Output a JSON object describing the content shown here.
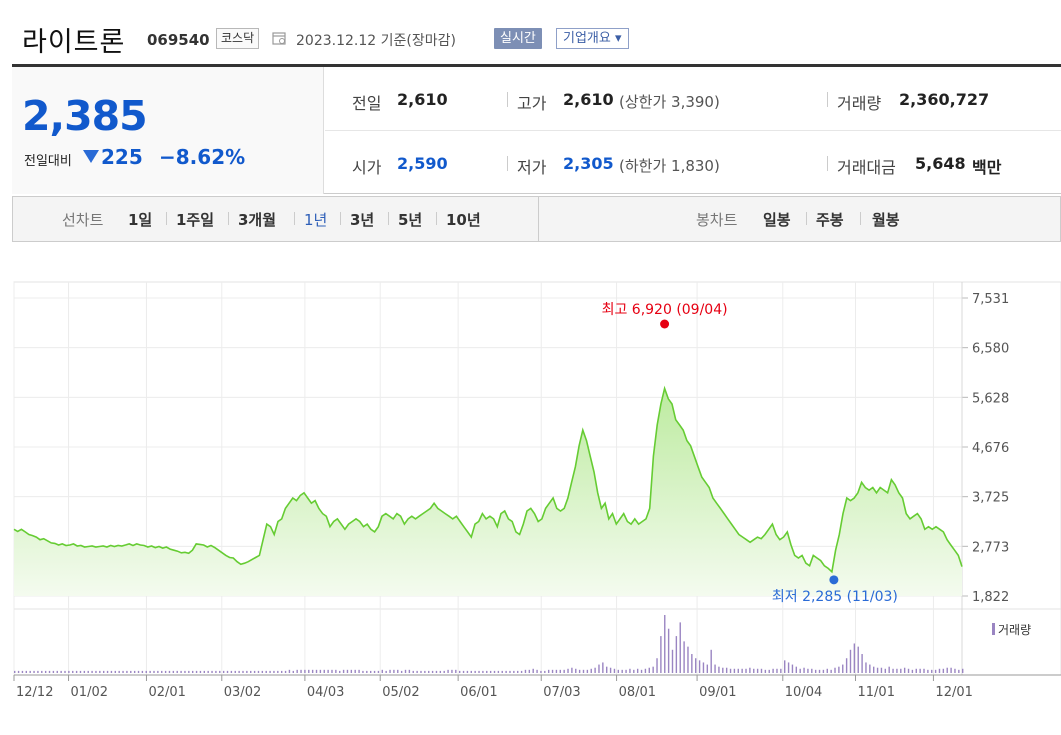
{
  "header": {
    "company_name": "라이트론",
    "code": "069540",
    "market_badge": "코스닥",
    "date_text": "2023.12.12  기준(장마감)",
    "realtime_label": "실시간",
    "company_info_label": "기업개요 ▾"
  },
  "summary": {
    "price": "2,385",
    "change_label": "전일대비",
    "change_value": "225",
    "change_pct": "−8.62%",
    "prev_label": "전일",
    "prev_value": "2,610",
    "open_label": "시가",
    "open_value": "2,590",
    "high_label": "고가",
    "high_value": "2,610",
    "high_sub": "(상한가 3,390)",
    "low_label": "저가",
    "low_value": "2,305",
    "low_sub": "(하한가 1,830)",
    "volume_label": "거래량",
    "volume_value": "2,360,727",
    "amount_label": "거래대금",
    "amount_value": "5,648",
    "amount_unit": "백만"
  },
  "tabs": {
    "line_label": "선차트",
    "periods": [
      "1일",
      "1주일",
      "3개월",
      "1년",
      "3년",
      "5년",
      "10년"
    ],
    "selected": "1년",
    "candle_label": "봉차트",
    "candles": [
      "일봉",
      "주봉",
      "월봉"
    ]
  },
  "colors": {
    "line": "#66cc33",
    "fill_top": "#bdeba0",
    "fill_bottom": "#f4fbef",
    "max_dot": "#e60012",
    "min_dot": "#2a6bd6",
    "volume": "#9a85c2"
  },
  "chart_data": {
    "type": "area",
    "title": "",
    "y_ticks": [
      "7,531",
      "6,580",
      "5,628",
      "4,676",
      "3,725",
      "2,773",
      "1,822"
    ],
    "ylim": [
      1822,
      7531
    ],
    "x_ticks": [
      "12/12",
      "01/02",
      "02/01",
      "03/02",
      "04/03",
      "05/02",
      "06/01",
      "07/03",
      "08/01",
      "09/01",
      "10/04",
      "11/01",
      "12/01"
    ],
    "grid": true,
    "max_annotation": "최고 6,920 (09/04)",
    "min_annotation": "최저 2,285 (11/03)",
    "volume_legend": "거래량",
    "series": [
      {
        "values": [
          3100,
          3060,
          3100,
          3050,
          3000,
          2980,
          2950,
          2900,
          2920,
          2880,
          2840,
          2830,
          2800,
          2820,
          2790,
          2800,
          2820,
          2780,
          2790,
          2760,
          2770,
          2780,
          2760,
          2770,
          2780,
          2760,
          2790,
          2770,
          2790,
          2780,
          2800,
          2820,
          2790,
          2820,
          2800,
          2790,
          2760,
          2780,
          2750,
          2770,
          2740,
          2760,
          2720,
          2700,
          2680,
          2650,
          2660,
          2640,
          2700,
          2820,
          2810,
          2800,
          2760,
          2790,
          2750,
          2700,
          2650,
          2600,
          2560,
          2550,
          2480,
          2430,
          2450,
          2480,
          2520,
          2560,
          2600,
          2900,
          3200,
          3150,
          3000,
          3250,
          3300,
          3500,
          3600,
          3700,
          3650,
          3750,
          3800,
          3700,
          3600,
          3650,
          3500,
          3400,
          3350,
          3150,
          3250,
          3300,
          3200,
          3100,
          3200,
          3250,
          3300,
          3250,
          3150,
          3200,
          3100,
          3050,
          3150,
          3350,
          3400,
          3350,
          3300,
          3400,
          3350,
          3200,
          3300,
          3350,
          3300,
          3350,
          3400,
          3450,
          3500,
          3600,
          3500,
          3450,
          3400,
          3350,
          3300,
          3350,
          3250,
          3150,
          3050,
          2950,
          3200,
          3250,
          3400,
          3300,
          3350,
          3300,
          3150,
          3400,
          3450,
          3300,
          3250,
          3050,
          3000,
          3200,
          3450,
          3500,
          3400,
          3250,
          3300,
          3500,
          3600,
          3700,
          3500,
          3450,
          3500,
          3700,
          4000,
          4300,
          4700,
          5000,
          4800,
          4500,
          4200,
          3800,
          3500,
          3600,
          3300,
          3400,
          3200,
          3300,
          3400,
          3250,
          3200,
          3300,
          3200,
          3250,
          3300,
          3500,
          4500,
          5100,
          5500,
          5800,
          5600,
          5500,
          5200,
          5100,
          5000,
          4800,
          4700,
          4500,
          4300,
          4100,
          4000,
          3900,
          3700,
          3600,
          3500,
          3400,
          3300,
          3200,
          3100,
          3000,
          2950,
          2900,
          2850,
          2900,
          2950,
          2920,
          3000,
          3100,
          3200,
          3000,
          2900,
          2950,
          3050,
          2800,
          2600,
          2550,
          2600,
          2450,
          2400,
          2600,
          2550,
          2500,
          2400,
          2350,
          2285,
          2700,
          3000,
          3400,
          3700,
          3650,
          3700,
          3800,
          4000,
          3900,
          3850,
          3900,
          3800,
          3900,
          3850,
          3800,
          4050,
          3950,
          3800,
          3700,
          3400,
          3300,
          3350,
          3400,
          3300,
          3100,
          3150,
          3100,
          3150,
          3100,
          3050,
          2900,
          2800,
          2700,
          2600,
          2385
        ]
      }
    ],
    "volume_bars": [
      2,
      2,
      2,
      2,
      2,
      2,
      2,
      2,
      2,
      2,
      2,
      2,
      2,
      2,
      2,
      2,
      2,
      2,
      2,
      2,
      2,
      2,
      2,
      2,
      2,
      2,
      2,
      2,
      2,
      2,
      2,
      2,
      2,
      2,
      2,
      2,
      2,
      2,
      2,
      2,
      2,
      2,
      2,
      2,
      2,
      2,
      2,
      2,
      2,
      2,
      2,
      2,
      2,
      2,
      2,
      2,
      2,
      2,
      2,
      2,
      2,
      2,
      2,
      2,
      2,
      2,
      2,
      2,
      2,
      2,
      2,
      3,
      2,
      3,
      3,
      3,
      3,
      3,
      3,
      3,
      3,
      3,
      3,
      3,
      2,
      3,
      3,
      3,
      3,
      3,
      2,
      2,
      2,
      2,
      2,
      3,
      2,
      3,
      3,
      3,
      2,
      3,
      3,
      2,
      2,
      2,
      2,
      2,
      2,
      2,
      2,
      2,
      3,
      3,
      3,
      2,
      2,
      2,
      2,
      2,
      2,
      2,
      2,
      2,
      2,
      2,
      2,
      2,
      2,
      2,
      2,
      2,
      3,
      3,
      4,
      3,
      2,
      2,
      3,
      3,
      3,
      3,
      3,
      4,
      5,
      4,
      3,
      3,
      3,
      4,
      5,
      8,
      10,
      6,
      5,
      4,
      3,
      3,
      3,
      4,
      3,
      4,
      3,
      4,
      5,
      6,
      14,
      35,
      55,
      42,
      22,
      35,
      48,
      30,
      25,
      18,
      14,
      12,
      10,
      8,
      22,
      8,
      6,
      5,
      5,
      4,
      4,
      4,
      4,
      4,
      5,
      4,
      4,
      4,
      3,
      3,
      4,
      4,
      4,
      12,
      10,
      8,
      6,
      4,
      5,
      4,
      4,
      3,
      3,
      3,
      4,
      3,
      5,
      6,
      8,
      14,
      22,
      28,
      25,
      18,
      10,
      8,
      6,
      5,
      5,
      4,
      6,
      4,
      4,
      4,
      5,
      4,
      3,
      4,
      4,
      4,
      3,
      3,
      3,
      4,
      4,
      5,
      5,
      4,
      3,
      4
    ]
  }
}
